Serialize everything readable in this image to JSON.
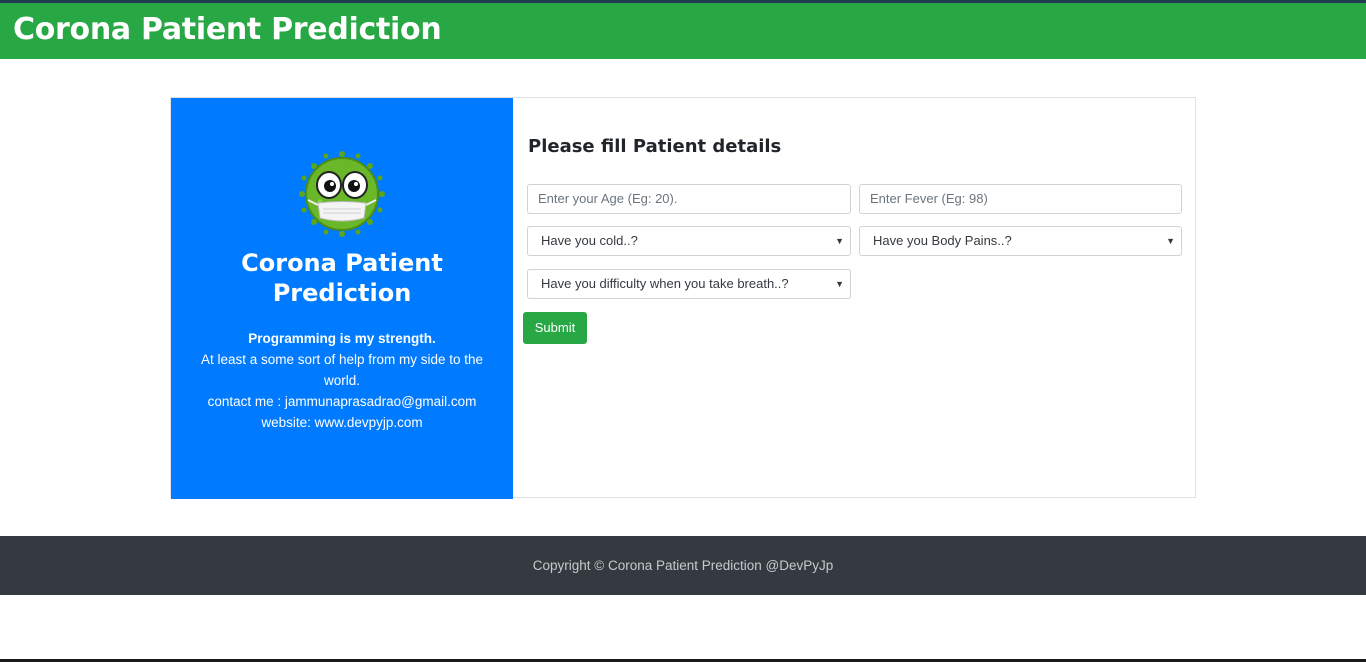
{
  "navbar": {
    "brand": "Corona Patient Prediction"
  },
  "side_panel": {
    "title": "Corona Patient Prediction",
    "tagline": "Programming is my strength.",
    "description": "At least a some sort of help from my side to the world.",
    "contact": "contact me : jammunaprasadrao@gmail.com",
    "website": "website: www.devpyjp.com"
  },
  "form": {
    "heading": "Please fill Patient details",
    "age_placeholder": "Enter your Age (Eg: 20).",
    "fever_placeholder": "Enter Fever (Eg: 98)",
    "cold_select": "Have you cold..?",
    "body_pains_select": "Have you Body Pains..?",
    "breath_select": "Have you difficulty when you take breath..?",
    "submit_label": "Submit"
  },
  "footer": {
    "copyright": "Copyright © Corona Patient Prediction @DevPyJp"
  },
  "colors": {
    "navbar": "#28a745",
    "side_panel": "#007bff",
    "footer": "#343a40",
    "submit": "#28a745"
  }
}
